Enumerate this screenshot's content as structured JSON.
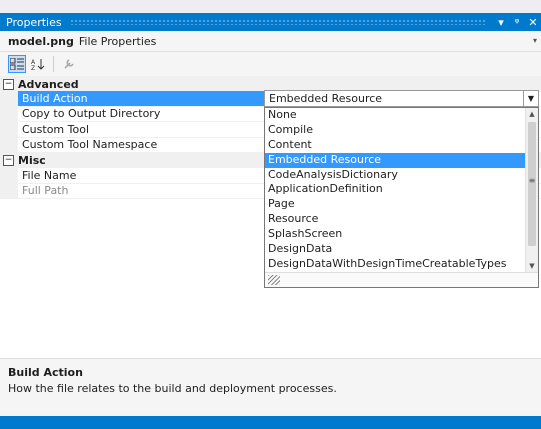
{
  "panel": {
    "title": "Properties"
  },
  "object_selector": {
    "name": "model.png",
    "type": "File Properties"
  },
  "toolbar": {
    "categorized_icon": "categorized-icon",
    "alphabetical_icon": "alphabetical-icon",
    "property_pages_icon": "wrench-icon"
  },
  "categories": [
    {
      "label": "Advanced",
      "toggle": "⊟"
    },
    {
      "label": "Misc",
      "toggle": "⊟"
    }
  ],
  "properties": {
    "advanced": [
      {
        "name": "Build Action",
        "value": "Embedded Resource"
      },
      {
        "name": "Copy to Output Directory",
        "value": ""
      },
      {
        "name": "Custom Tool",
        "value": ""
      },
      {
        "name": "Custom Tool Namespace",
        "value": ""
      }
    ],
    "misc": [
      {
        "name": "File Name",
        "value": ""
      },
      {
        "name": "Full Path",
        "value": ""
      }
    ]
  },
  "dropdown": {
    "selected": "Embedded Resource",
    "options": [
      "None",
      "Compile",
      "Content",
      "Embedded Resource",
      "CodeAnalysisDictionary",
      "ApplicationDefinition",
      "Page",
      "Resource",
      "SplashScreen",
      "DesignData",
      "DesignDataWithDesignTimeCreatableTypes"
    ]
  },
  "description": {
    "title": "Build Action",
    "text": "How the file relates to the build and deployment processes."
  },
  "colors": {
    "accent": "#007acc",
    "selection": "#3399ff"
  }
}
